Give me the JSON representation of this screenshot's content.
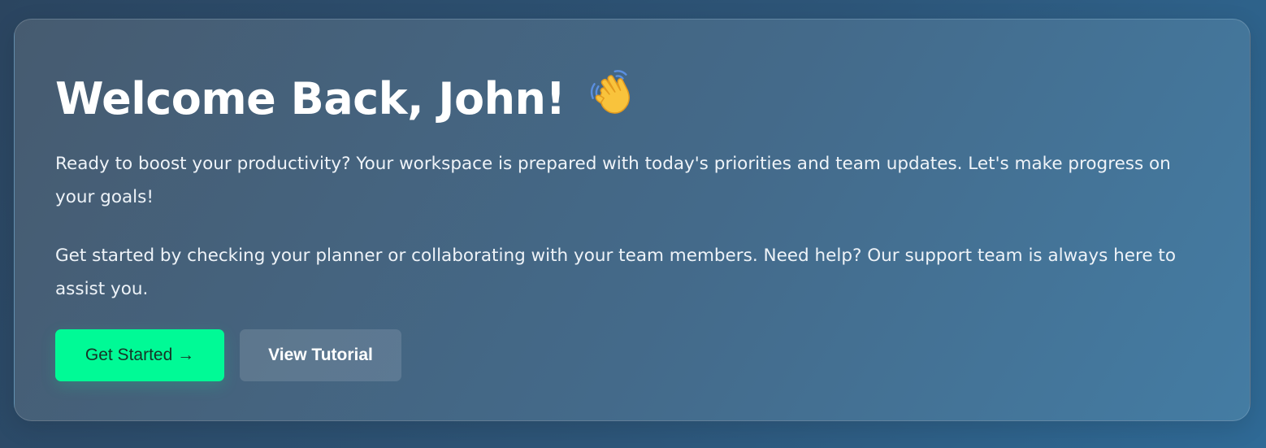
{
  "welcome": {
    "title": "Welcome Back, John!",
    "icon": "waving-hand-icon",
    "paragraph_1": "Ready to boost your productivity? Your workspace is prepared with today's priorities and team updates. Let's make progress on your goals!",
    "paragraph_2": "Get started by checking your planner or collaborating with your team members. Need help? Our support team is always here to assist you."
  },
  "actions": {
    "primary_label": "Get Started →",
    "secondary_label": "View Tutorial"
  },
  "colors": {
    "primary_button": "#00fa96",
    "card_background": "#456a89",
    "page_background": "#2d5578"
  }
}
